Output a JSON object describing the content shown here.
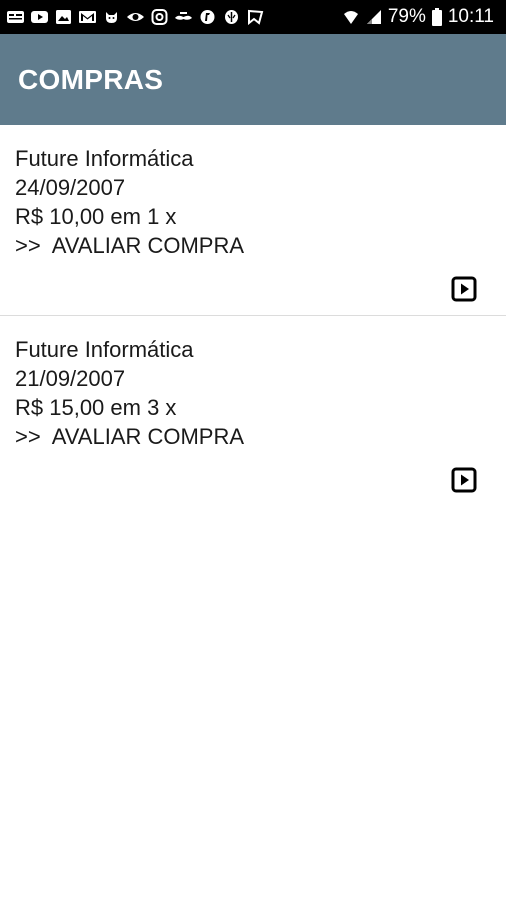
{
  "status_bar": {
    "notification_icons": [
      "news-icon",
      "youtube-icon",
      "image-icon",
      "gmail-icon",
      "cat-icon",
      "eye-icon",
      "instagram-icon",
      "mustache-icon",
      "app-icon",
      "alien-icon",
      "cast-icon"
    ],
    "battery": "79%",
    "time": "10:11"
  },
  "app_bar": {
    "title": "COMPRAS",
    "color": "#5f7b8c"
  },
  "purchases": [
    {
      "store": "Future Informática",
      "date": "24/09/2007",
      "amount": "R$ 10,00 em 1 x",
      "action": ">>  AVALIAR COMPRA"
    },
    {
      "store": "Future Informática",
      "date": "21/09/2007",
      "amount": "R$ 15,00 em 3 x",
      "action": ">>  AVALIAR COMPRA"
    }
  ]
}
